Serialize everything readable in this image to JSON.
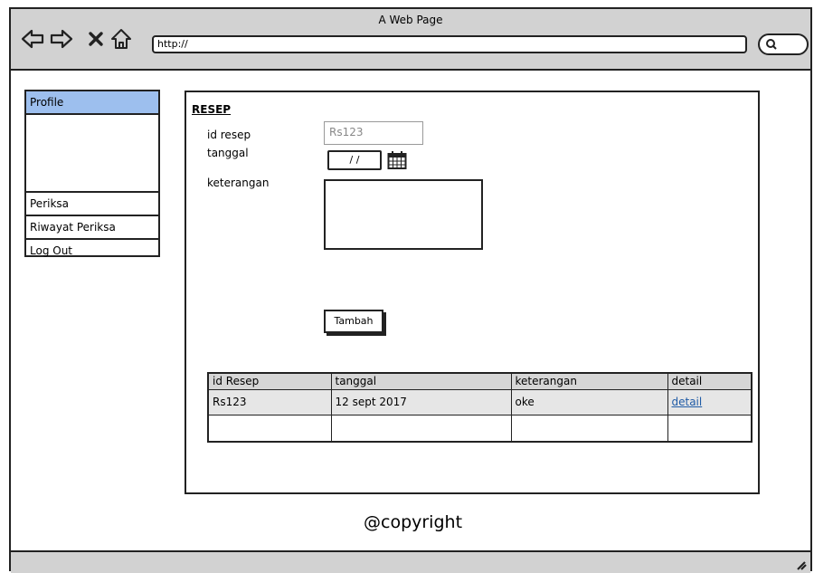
{
  "window": {
    "title": "A Web Page"
  },
  "toolbar": {
    "url": "http://",
    "icons": [
      "back-icon",
      "forward-icon",
      "close-icon",
      "home-icon",
      "search-icon"
    ]
  },
  "sidebar": {
    "items": [
      {
        "label": "Profile",
        "active": true
      },
      {
        "label": "Periksa"
      },
      {
        "label": "Riwayat Periksa"
      },
      {
        "label": "Log Out"
      }
    ]
  },
  "form": {
    "heading": "RESEP",
    "id_label": "id resep",
    "id_value": "Rs123",
    "date_label": "tanggal",
    "date_value": "/ /",
    "note_label": "keterangan",
    "submit_label": "Tambah"
  },
  "table": {
    "headers": [
      "id Resep",
      "tanggal",
      "keterangan",
      "detail"
    ],
    "rows": [
      [
        "Rs123",
        "12 sept 2017",
        "oke",
        "detail"
      ],
      [
        "",
        "",
        "",
        ""
      ]
    ]
  },
  "footer": {
    "text": "@copyright"
  },
  "colors": {
    "accent": "#9dbfee",
    "chrome": "#d2d2d2",
    "link": "#1f5ba6"
  }
}
